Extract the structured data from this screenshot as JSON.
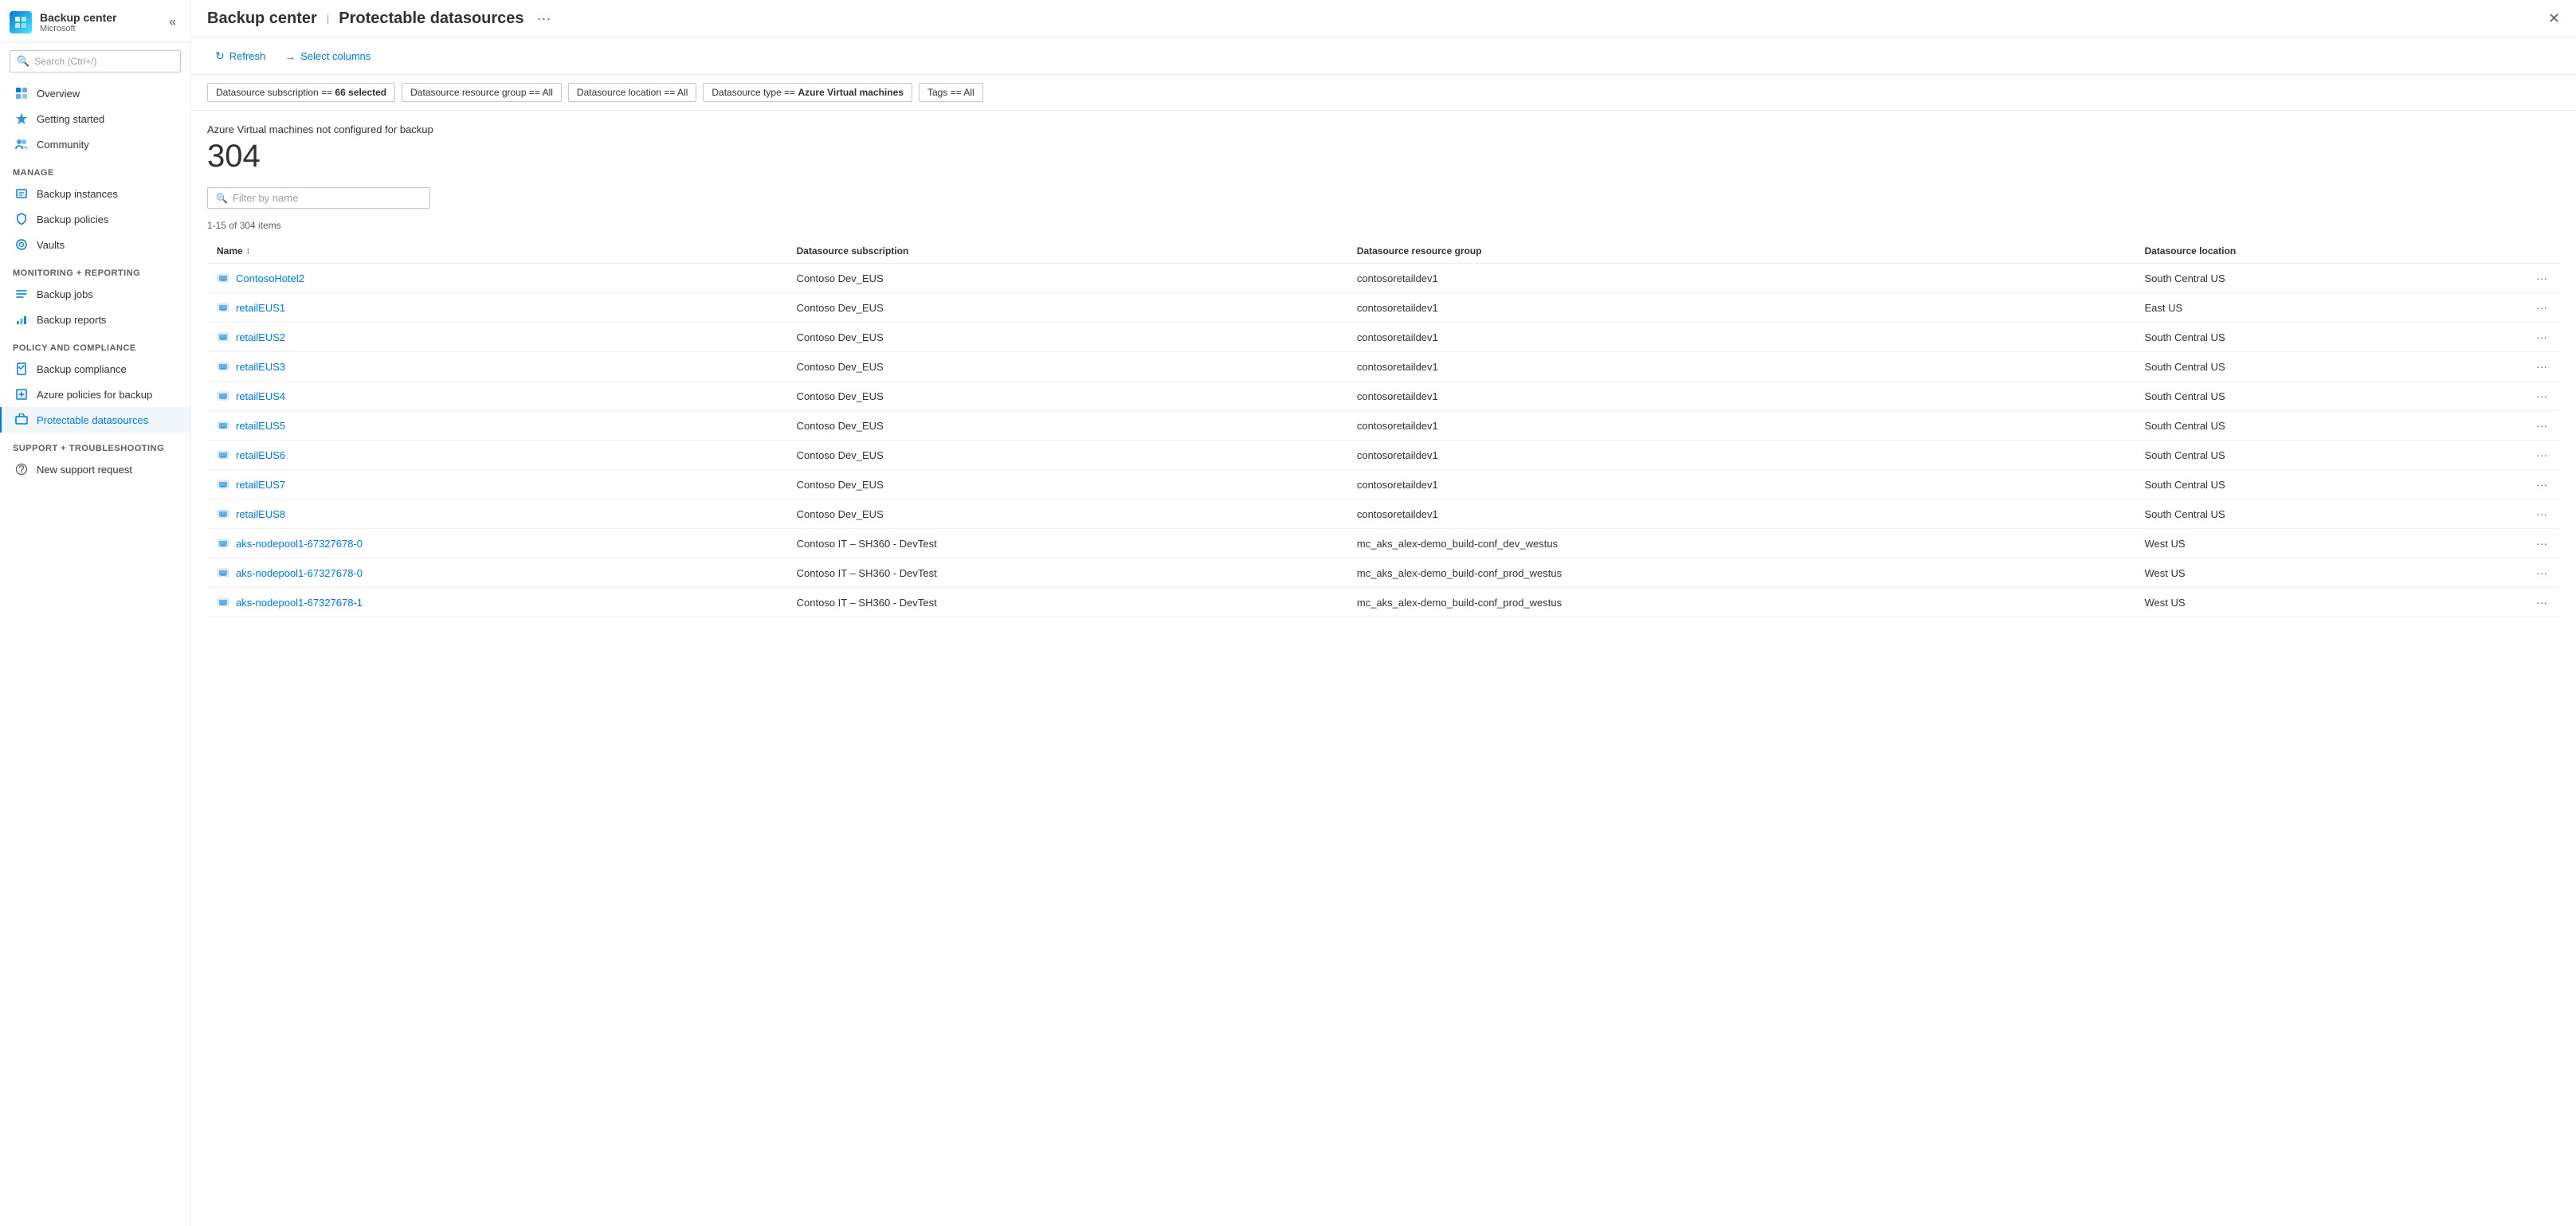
{
  "app": {
    "name": "Backup center",
    "subtitle": "Protectable datasources",
    "provider": "Microsoft",
    "logo_char": "+"
  },
  "sidebar": {
    "search_placeholder": "Search (Ctrl+/)",
    "collapse_icon": "«",
    "nav_items_top": [
      {
        "id": "overview",
        "label": "Overview",
        "icon": "grid"
      },
      {
        "id": "getting-started",
        "label": "Getting started",
        "icon": "rocket"
      },
      {
        "id": "community",
        "label": "Community",
        "icon": "people"
      }
    ],
    "sections": [
      {
        "label": "Manage",
        "items": [
          {
            "id": "backup-instances",
            "label": "Backup instances",
            "icon": "database"
          },
          {
            "id": "backup-policies",
            "label": "Backup policies",
            "icon": "shield"
          },
          {
            "id": "vaults",
            "label": "Vaults",
            "icon": "vault"
          }
        ]
      },
      {
        "label": "Monitoring + reporting",
        "items": [
          {
            "id": "backup-jobs",
            "label": "Backup jobs",
            "icon": "list"
          },
          {
            "id": "backup-reports",
            "label": "Backup reports",
            "icon": "chart"
          }
        ]
      },
      {
        "label": "Policy and compliance",
        "items": [
          {
            "id": "backup-compliance",
            "label": "Backup compliance",
            "icon": "compliance"
          },
          {
            "id": "azure-policies",
            "label": "Azure policies for backup",
            "icon": "policy"
          },
          {
            "id": "protectable-datasources",
            "label": "Protectable datasources",
            "icon": "datasource",
            "active": true
          }
        ]
      },
      {
        "label": "Support + troubleshooting",
        "items": [
          {
            "id": "new-support-request",
            "label": "New support request",
            "icon": "support"
          }
        ]
      }
    ]
  },
  "toolbar": {
    "refresh_label": "Refresh",
    "select_columns_label": "Select columns"
  },
  "filters": [
    {
      "id": "subscription",
      "label": "Datasource subscription == ",
      "value": "66 selected",
      "bold": true
    },
    {
      "id": "resource-group",
      "label": "Datasource resource group == ",
      "value": "All"
    },
    {
      "id": "location",
      "label": "Datasource location == ",
      "value": "All"
    },
    {
      "id": "type",
      "label": "Datasource type == ",
      "value": "Azure Virtual machines",
      "bold": true
    },
    {
      "id": "tags",
      "label": "Tags == ",
      "value": "All"
    }
  ],
  "summary": {
    "title": "Azure Virtual machines not configured for backup",
    "count": "304"
  },
  "filter_input": {
    "placeholder": "Filter by name"
  },
  "items_count": "1-15 of 304 items",
  "table": {
    "columns": [
      {
        "id": "name",
        "label": "Name",
        "sortable": true
      },
      {
        "id": "subscription",
        "label": "Datasource subscription",
        "sortable": false
      },
      {
        "id": "resource-group",
        "label": "Datasource resource group",
        "sortable": false
      },
      {
        "id": "location",
        "label": "Datasource location",
        "sortable": false
      }
    ],
    "rows": [
      {
        "name": "ContosoHotel2",
        "subscription": "Contoso Dev_EUS",
        "resource_group": "contosoretaildev1",
        "location": "South Central US"
      },
      {
        "name": "retailEUS1",
        "subscription": "Contoso Dev_EUS",
        "resource_group": "contosoretaildev1",
        "location": "East US"
      },
      {
        "name": "retailEUS2",
        "subscription": "Contoso Dev_EUS",
        "resource_group": "contosoretaildev1",
        "location": "South Central US"
      },
      {
        "name": "retailEUS3",
        "subscription": "Contoso Dev_EUS",
        "resource_group": "contosoretaildev1",
        "location": "South Central US"
      },
      {
        "name": "retailEUS4",
        "subscription": "Contoso Dev_EUS",
        "resource_group": "contosoretaildev1",
        "location": "South Central US"
      },
      {
        "name": "retailEUS5",
        "subscription": "Contoso Dev_EUS",
        "resource_group": "contosoretaildev1",
        "location": "South Central US"
      },
      {
        "name": "retailEUS6",
        "subscription": "Contoso Dev_EUS",
        "resource_group": "contosoretaildev1",
        "location": "South Central US"
      },
      {
        "name": "retailEUS7",
        "subscription": "Contoso Dev_EUS",
        "resource_group": "contosoretaildev1",
        "location": "South Central US"
      },
      {
        "name": "retailEUS8",
        "subscription": "Contoso Dev_EUS",
        "resource_group": "contosoretaildev1",
        "location": "South Central US"
      },
      {
        "name": "aks-nodepool1-67327678-0",
        "subscription": "Contoso IT – SH360 - DevTest",
        "resource_group": "mc_aks_alex-demo_build-conf_dev_westus",
        "location": "West US"
      },
      {
        "name": "aks-nodepool1-67327678-0",
        "subscription": "Contoso IT – SH360 - DevTest",
        "resource_group": "mc_aks_alex-demo_build-conf_prod_westus",
        "location": "West US"
      },
      {
        "name": "aks-nodepool1-67327678-1",
        "subscription": "Contoso IT – SH360 - DevTest",
        "resource_group": "mc_aks_alex-demo_build-conf_prod_westus",
        "location": "West US"
      }
    ]
  },
  "colors": {
    "accent": "#0078d4",
    "active_bg": "#eff6fc",
    "active_border": "#0078d4",
    "border": "#edebe9",
    "text_secondary": "#605e5c",
    "vm_icon_color": "#0078d4"
  }
}
